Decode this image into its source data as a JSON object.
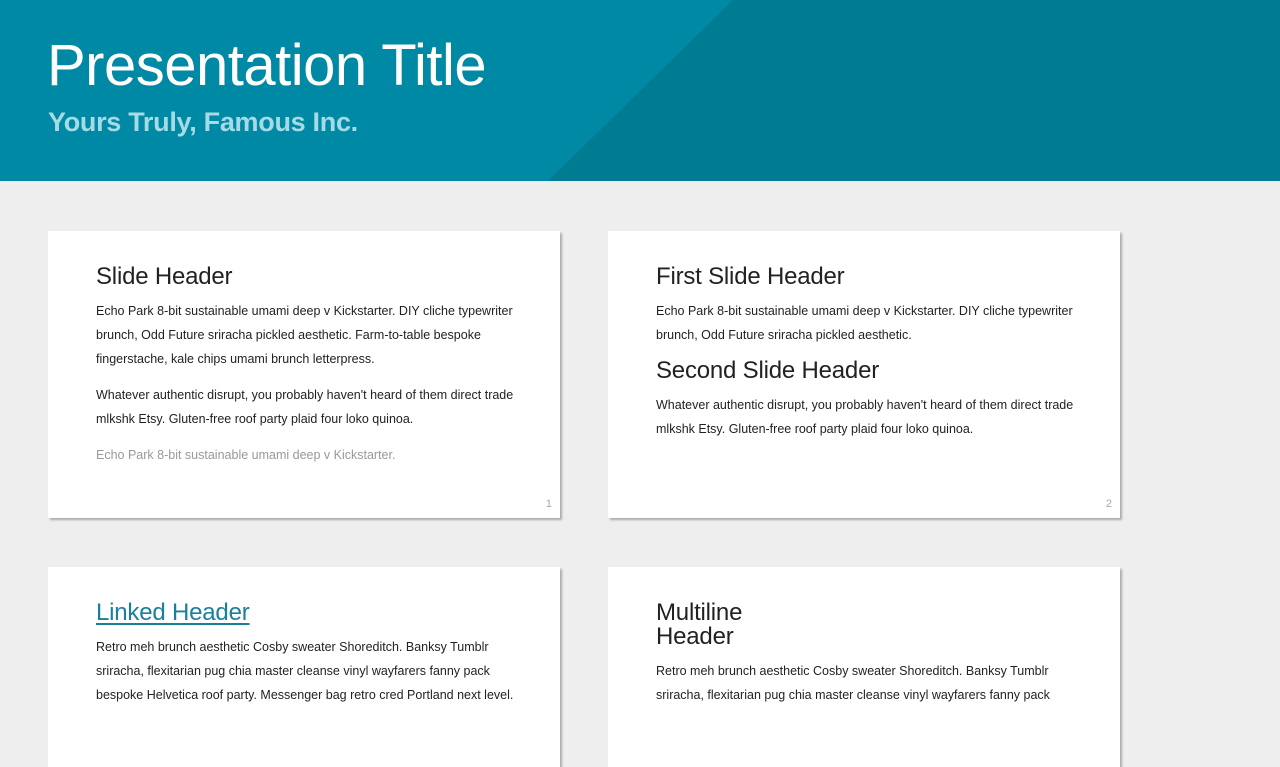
{
  "header": {
    "title": "Presentation Title",
    "subtitle": "Yours Truly, Famous Inc."
  },
  "colors": {
    "banner": "#0089a4",
    "banner_shade": "#007c92",
    "subtitle": "#a6dbe6",
    "link": "#1a7f9c",
    "background": "#eeeeee"
  },
  "slides": [
    {
      "header": "Slide Header",
      "paragraphs": [
        "Echo Park 8-bit sustainable umami deep v Kickstarter. DIY cliche typewriter brunch, Odd Future sriracha pickled aesthetic. Farm-to-table bespoke fingerstache, kale chips umami brunch letterpress.",
        "Whatever authentic disrupt, you probably haven't heard of them direct trade mlkshk Etsy. Gluten-free roof party plaid four loko quinoa."
      ],
      "muted": "Echo Park 8-bit sustainable umami deep v Kickstarter.",
      "page": "1"
    },
    {
      "header": "First Slide Header",
      "paragraph": "Echo Park 8-bit sustainable umami deep v Kickstarter. DIY cliche typewriter brunch, Odd Future sriracha pickled aesthetic.",
      "header2": "Second Slide Header",
      "paragraph2": "Whatever authentic disrupt, you probably haven't heard of them direct trade mlkshk Etsy. Gluten-free roof party plaid four loko quinoa.",
      "page": "2"
    },
    {
      "header": "Linked Header",
      "paragraph": "Retro meh brunch aesthetic Cosby sweater Shoreditch. Banksy Tumblr sriracha, flexitarian pug chia master cleanse vinyl wayfarers fanny pack bespoke Helvetica roof party. Messenger bag retro cred Portland next level."
    },
    {
      "header": "Multiline\nHeader",
      "paragraph": "Retro meh brunch aesthetic Cosby sweater Shoreditch. Banksy Tumblr sriracha, flexitarian pug chia master cleanse vinyl wayfarers fanny pack"
    }
  ]
}
